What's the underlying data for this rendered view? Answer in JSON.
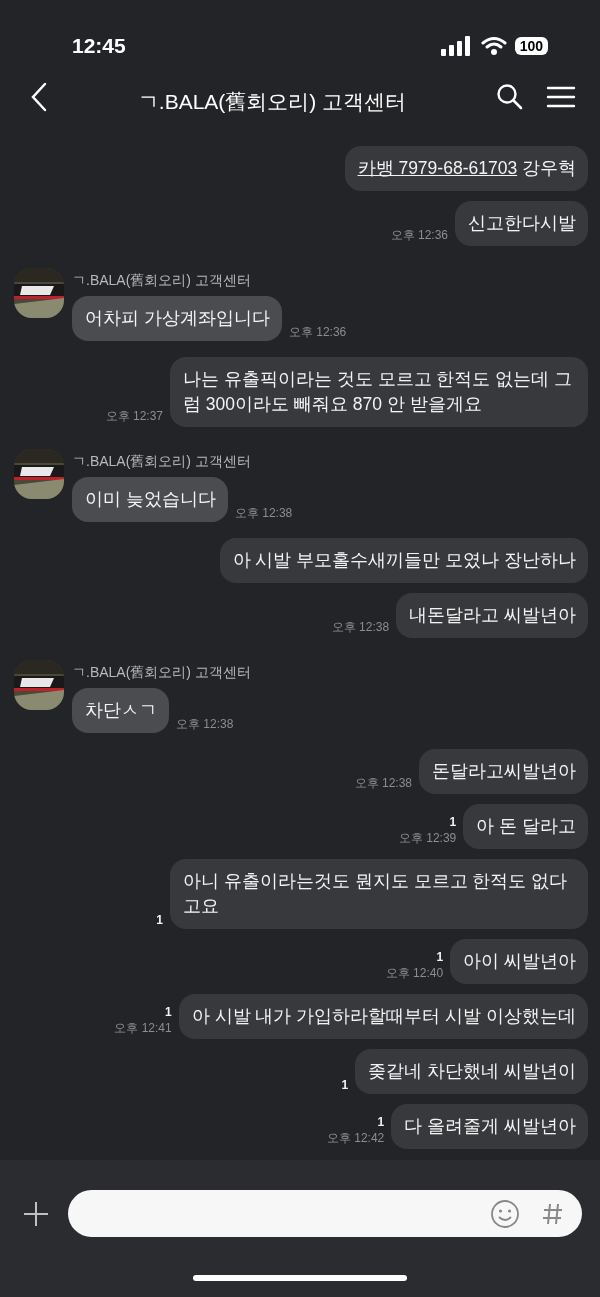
{
  "status_bar": {
    "time": "12:45",
    "battery": "100"
  },
  "header": {
    "title": "ㄱ.BALA(舊회오리) 고객센터"
  },
  "messages": [
    {
      "kind": "sent",
      "link": "카뱅 7979-68-61703",
      "text": "강우혁"
    },
    {
      "kind": "sent",
      "text": "신고한다시발",
      "time": "오후 12:36"
    },
    {
      "kind": "received",
      "sender": "ㄱ.BALA(舊회오리) 고객센터",
      "text": "어차피 가상계좌입니다",
      "time": "오후 12:36"
    },
    {
      "kind": "sent",
      "text": "나는 유출픽이라는 것도 모르고 한적도 없는데 그럼 300이라도 빼줘요 870 안 받을게요",
      "time": "오후 12:37"
    },
    {
      "kind": "received",
      "sender": "ㄱ.BALA(舊회오리) 고객센터",
      "text": "이미 늦었습니다",
      "time": "오후 12:38"
    },
    {
      "kind": "sent",
      "text": "아 시발 부모홀수새끼들만 모였나 장난하나"
    },
    {
      "kind": "sent",
      "text": "내돈달라고 씨발년아",
      "time": "오후 12:38"
    },
    {
      "kind": "received",
      "sender": "ㄱ.BALA(舊회오리) 고객센터",
      "text": "차단ㅅㄱ",
      "time": "오후 12:38"
    },
    {
      "kind": "sent",
      "text": "돈달라고씨발년아",
      "time": "오후 12:38"
    },
    {
      "kind": "sent",
      "text": "아 돈 달라고",
      "unread": "1",
      "time": "오후 12:39"
    },
    {
      "kind": "sent",
      "text": "아니 유출이라는것도 뭔지도 모르고 한적도 없다고요",
      "unread": "1"
    },
    {
      "kind": "sent",
      "text": "아이 씨발년아",
      "unread": "1",
      "time": "오후 12:40"
    },
    {
      "kind": "sent",
      "text": "아 시발 내가 가입하라할때부터 시발 이상했는데",
      "unread": "1",
      "time": "오후 12:41"
    },
    {
      "kind": "sent",
      "text": "좆같네 차단했네 씨발년이",
      "unread": "1"
    },
    {
      "kind": "sent",
      "text": "다 올려줄게 씨발년아",
      "unread": "1",
      "time": "오후 12:42"
    }
  ]
}
